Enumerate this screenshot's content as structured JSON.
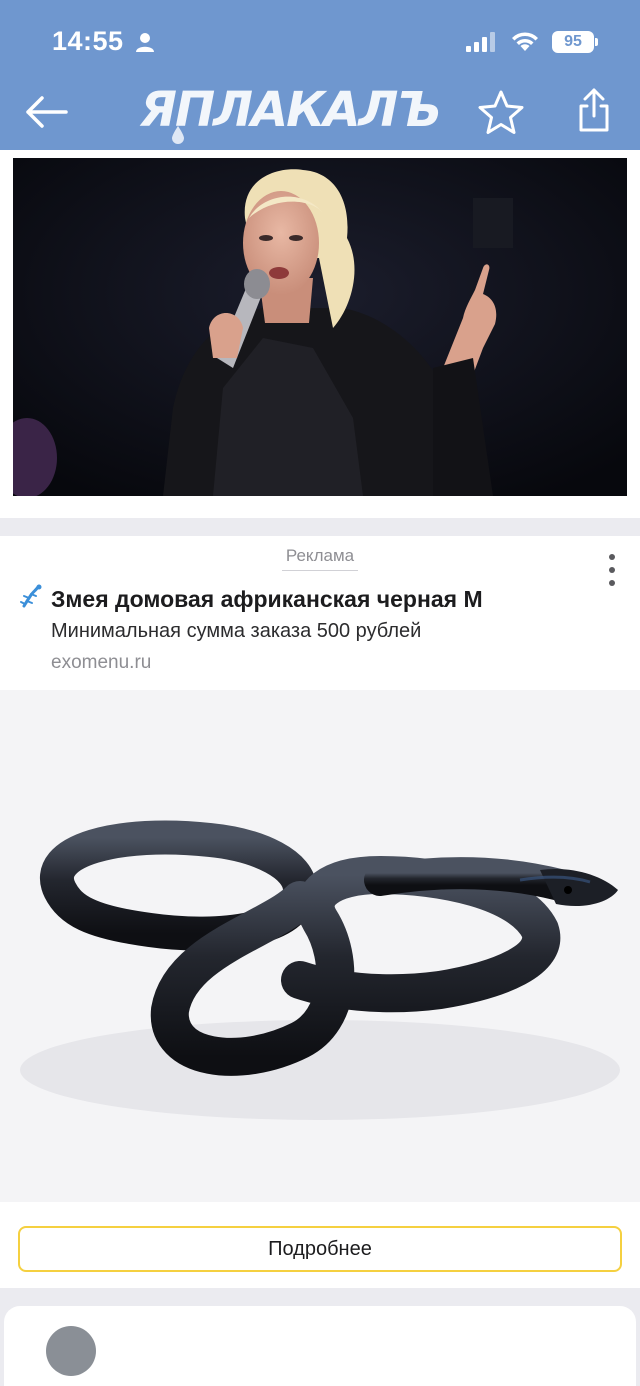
{
  "status_bar": {
    "time": "14:55",
    "battery_level": "95",
    "icons": [
      "person-icon",
      "signal-icon",
      "wifi-icon",
      "battery-icon"
    ]
  },
  "nav_bar": {
    "logo_text": "ЯПЛАКАЛЪ",
    "buttons": [
      "back-arrow-icon",
      "star-icon",
      "share-icon"
    ],
    "background_color": "#6f97cf"
  },
  "ad": {
    "label": "Реклама",
    "title": "Змея домовая африканская черная М",
    "subtitle": "Минимальная сумма заказа 500 рублей",
    "domain": "exomenu.ru",
    "button_label": "Подробнее",
    "button_border_color": "#f5d040"
  }
}
